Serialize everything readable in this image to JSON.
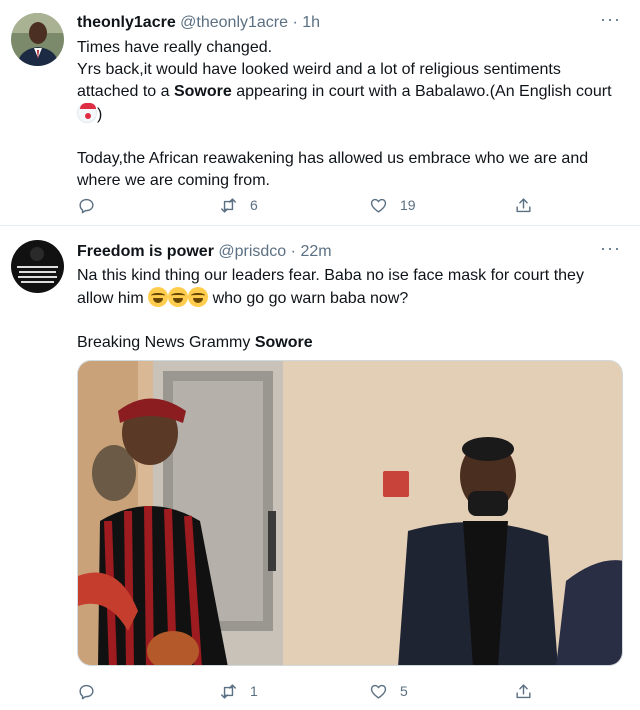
{
  "tweets": [
    {
      "name": "theonly1acre",
      "handle": "@theonly1acre",
      "sep": "·",
      "time": "1h",
      "lines": [
        "Times have really changed.",
        "Yrs back,it would have looked weird and a lot of religious sentiments attached to a ",
        "Sowore",
        " appearing in court with a Babalawo.(An English court ",
        ")",
        "Today,the African reawakening has allowed us embrace who we are and where we are coming from."
      ],
      "emoji": [
        "clown-face-icon"
      ],
      "retweets": "6",
      "likes": "19"
    },
    {
      "name": "Freedom is power",
      "handle": "@prisdco",
      "sep": "·",
      "time": "22m",
      "line1": "Na this kind thing our leaders fear. Baba no ise face mask for court they allow him ",
      "line1_end": " who go go warn baba now?",
      "emoji": [
        "rolling-laughing-icon",
        "rolling-laughing-icon",
        "rolling-laughing-icon"
      ],
      "line2_prefix": "Breaking News Grammy ",
      "line2_bold": "Sowore",
      "retweets": "1",
      "likes": "5"
    }
  ],
  "colors": {
    "text": "#0f1419",
    "secondary": "#5b7083",
    "border": "#e6ecf0"
  }
}
